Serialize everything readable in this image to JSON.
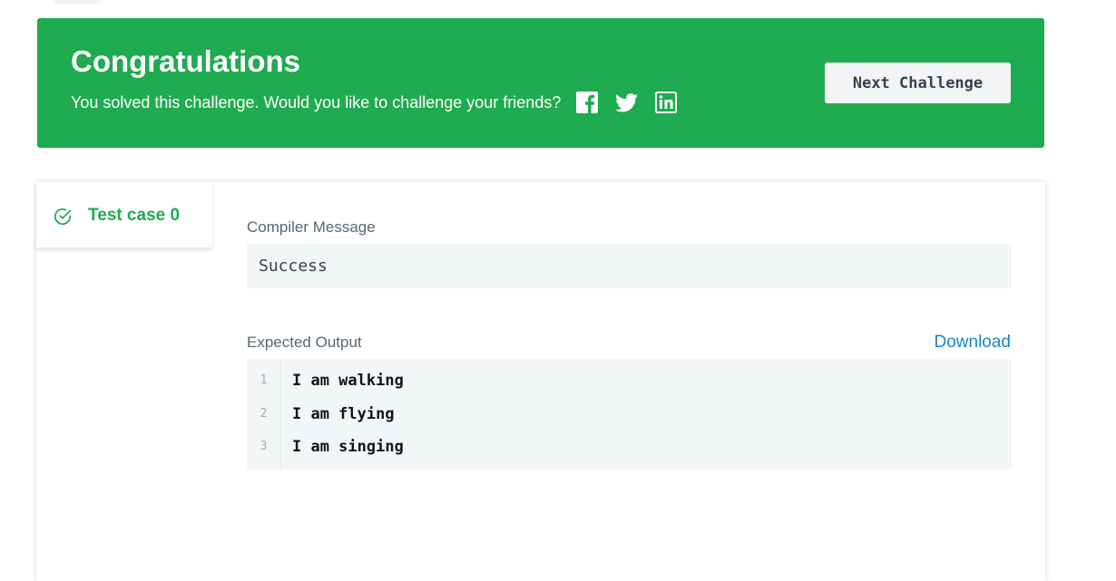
{
  "banner": {
    "title": "Congratulations",
    "subtitle": "You solved this challenge. Would you like to challenge your friends?",
    "share_icons": [
      "facebook-icon",
      "twitter-icon",
      "linkedin-icon"
    ],
    "next_button_label": "Next Challenge",
    "background_color": "#1fab4f"
  },
  "tabs": [
    {
      "label": "Test case 0",
      "status": "passed",
      "icon": "check-circle-icon",
      "color": "#1fab4f"
    }
  ],
  "compiler": {
    "label": "Compiler Message",
    "message": "Success"
  },
  "expected_output": {
    "label": "Expected Output",
    "download_label": "Download",
    "lines": [
      {
        "num": "1",
        "text": "I am walking"
      },
      {
        "num": "2",
        "text": "I am flying"
      },
      {
        "num": "3",
        "text": "I am singing"
      }
    ]
  }
}
